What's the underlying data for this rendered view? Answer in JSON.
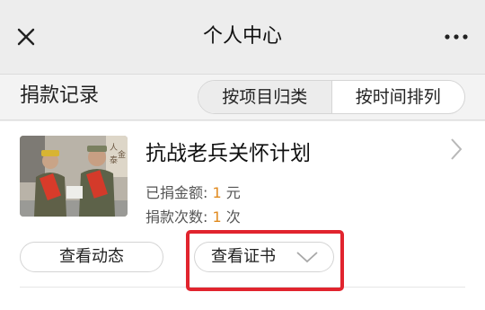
{
  "nav": {
    "title": "个人中心"
  },
  "section": {
    "title": "捐款记录",
    "tabs": [
      {
        "label": "按项目归类",
        "active": true
      },
      {
        "label": "按时间排列",
        "active": false
      }
    ]
  },
  "donation": {
    "project_title": "抗战老兵关怀计划",
    "amount_label": "已捐金额: ",
    "amount_value": "1",
    "amount_unit": " 元",
    "count_label": "捐款次数: ",
    "count_value": "1",
    "count_unit": " 次",
    "view_updates_label": "查看动态",
    "view_certificate_label": "查看证书"
  },
  "colors": {
    "highlight": "#e1242e",
    "accent_number": "#e08a1e",
    "background": "#ededed"
  }
}
